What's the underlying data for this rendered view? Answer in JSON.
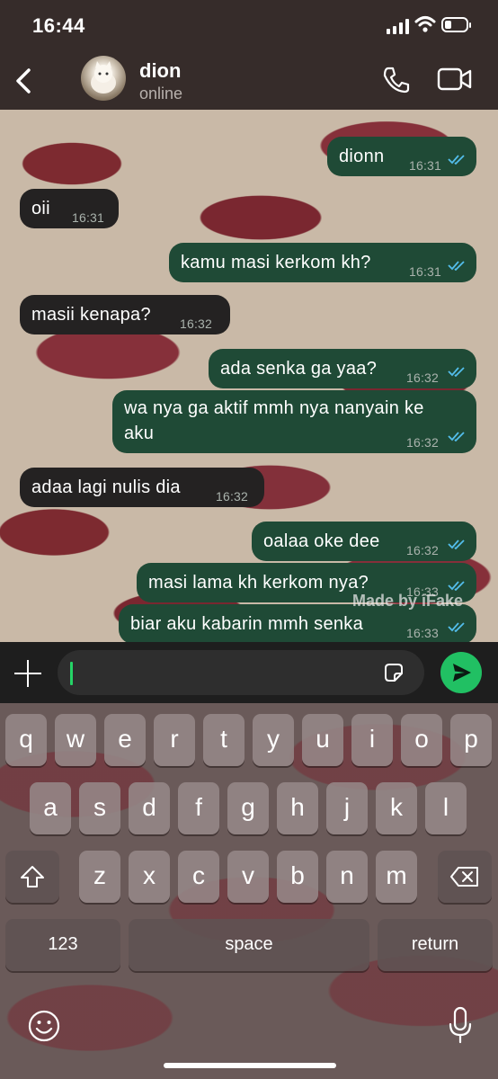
{
  "status_bar": {
    "time": "16:44",
    "battery_level": 0.3
  },
  "header": {
    "back_icon": "chevron-left-icon",
    "contact_name": "dion",
    "presence": "online",
    "call_icon": "phone-icon",
    "video_icon": "video-camera-icon"
  },
  "chat": {
    "wallpaper": "red lipstick kisses",
    "colors": {
      "outgoing_bubble": "#1f4a36",
      "incoming_bubble": "#242222",
      "read_ticks": "#53bdeb"
    },
    "messages": [
      {
        "dir": "out",
        "text": "dionn",
        "time": "16:31",
        "read": true
      },
      {
        "dir": "in",
        "text": "oii",
        "time": "16:31"
      },
      {
        "dir": "out",
        "text": "kamu masi kerkom kh?",
        "time": "16:31",
        "read": true
      },
      {
        "dir": "in",
        "text": "masii kenapa?",
        "time": "16:32"
      },
      {
        "dir": "out",
        "text": "ada senka ga yaa?",
        "time": "16:32",
        "read": true
      },
      {
        "dir": "out",
        "text_line1": "wa nya ga aktif mmh nya nanyain ke",
        "text_line2": "aku",
        "time": "16:32",
        "read": true
      },
      {
        "dir": "in",
        "text": "adaa lagi nulis dia",
        "time": "16:32"
      },
      {
        "dir": "out",
        "text": "oalaa oke dee",
        "time": "16:32",
        "read": true
      },
      {
        "dir": "out",
        "text": "masi lama kh kerkom nya?",
        "time": "16:33",
        "read": true
      },
      {
        "dir": "out",
        "text": "biar aku kabarin mmh senka",
        "time": "16:33",
        "read": true
      }
    ],
    "watermark": "Made by iFake"
  },
  "input_bar": {
    "attach_icon": "plus-icon",
    "message_value": "",
    "sticker_icon": "sticker-icon",
    "send_icon": "send-icon",
    "accent": "#21c063"
  },
  "keyboard": {
    "row1": [
      "q",
      "w",
      "e",
      "r",
      "t",
      "y",
      "u",
      "i",
      "o",
      "p"
    ],
    "row2": [
      "a",
      "s",
      "d",
      "f",
      "g",
      "h",
      "j",
      "k",
      "l"
    ],
    "row3": [
      "z",
      "x",
      "c",
      "v",
      "b",
      "n",
      "m"
    ],
    "shift_icon": "shift-icon",
    "delete_icon": "backspace-icon",
    "numbers_label": "123",
    "space_label": "space",
    "return_label": "return",
    "emoji_icon": "emoji-icon",
    "mic_icon": "microphone-icon"
  }
}
